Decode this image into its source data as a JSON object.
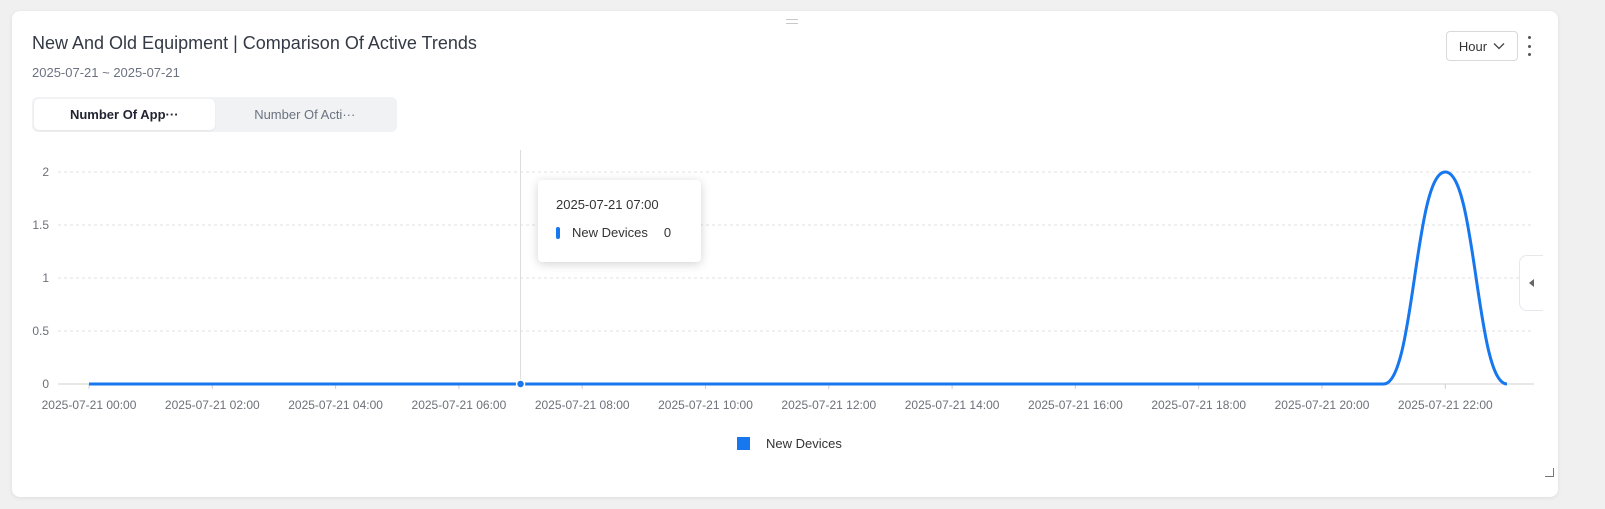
{
  "header": {
    "title": "New And Old Equipment | Comparison Of Active Trends",
    "date_range": "2025-07-21 ~ 2025-07-21",
    "granularity": "Hour"
  },
  "tabs": [
    {
      "label": "Number Of App···",
      "active": true
    },
    {
      "label": "Number Of Acti···",
      "active": false
    }
  ],
  "tooltip": {
    "time": "2025-07-21 07:00",
    "series": "New Devices",
    "value": "0"
  },
  "icons": {
    "more": "more-vertical-icon",
    "dropdown": "chevron-down-icon",
    "collapse": "caret-left-icon"
  },
  "colors": {
    "series": "#1677ef"
  },
  "chart_data": {
    "type": "line",
    "smooth": true,
    "x": [
      "2025-07-21 00:00",
      "2025-07-21 01:00",
      "2025-07-21 02:00",
      "2025-07-21 03:00",
      "2025-07-21 04:00",
      "2025-07-21 05:00",
      "2025-07-21 06:00",
      "2025-07-21 07:00",
      "2025-07-21 08:00",
      "2025-07-21 09:00",
      "2025-07-21 10:00",
      "2025-07-21 11:00",
      "2025-07-21 12:00",
      "2025-07-21 13:00",
      "2025-07-21 14:00",
      "2025-07-21 15:00",
      "2025-07-21 16:00",
      "2025-07-21 17:00",
      "2025-07-21 18:00",
      "2025-07-21 19:00",
      "2025-07-21 20:00",
      "2025-07-21 21:00",
      "2025-07-21 22:00",
      "2025-07-21 23:00"
    ],
    "x_tick_labels": [
      "2025-07-21 00:00",
      "2025-07-21 02:00",
      "2025-07-21 04:00",
      "2025-07-21 06:00",
      "2025-07-21 08:00",
      "2025-07-21 10:00",
      "2025-07-21 12:00",
      "2025-07-21 14:00",
      "2025-07-21 16:00",
      "2025-07-21 18:00",
      "2025-07-21 20:00",
      "2025-07-21 22:00"
    ],
    "series": [
      {
        "name": "New Devices",
        "values": [
          0,
          0,
          0,
          0,
          0,
          0,
          0,
          0,
          0,
          0,
          0,
          0,
          0,
          0,
          0,
          0,
          0,
          0,
          0,
          0,
          0,
          0,
          2,
          0
        ]
      }
    ],
    "y_ticks": [
      "0",
      "0.5",
      "1",
      "1.5",
      "2"
    ],
    "ylim": [
      0,
      2
    ],
    "grid": true,
    "legend": "bottom-center",
    "highlight_index": 7
  }
}
